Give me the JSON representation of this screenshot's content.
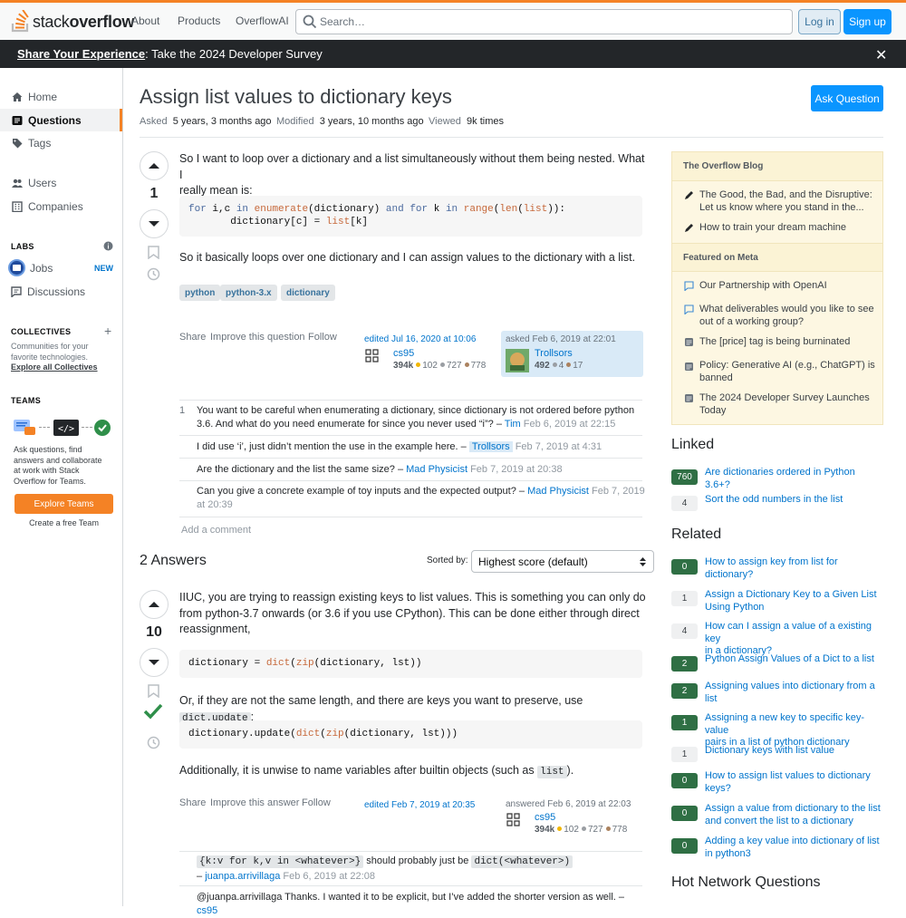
{
  "header": {
    "logo_light": "stack",
    "logo_bold": "overflow",
    "nav": [
      "About",
      "Products",
      "OverflowAI"
    ],
    "search_placeholder": "Search…",
    "login": "Log in",
    "signup": "Sign up",
    "accent": "#f48225"
  },
  "banner": {
    "link": "Share Your Experience",
    "text": ": Take the 2024 Developer Survey",
    "close": "✕"
  },
  "leftnav": {
    "home": "Home",
    "questions": "Questions",
    "tags": "Tags",
    "users": "Users",
    "companies": "Companies",
    "labs_title": "LABS",
    "jobs": "Jobs",
    "new_badge": "NEW",
    "discussions": "Discussions",
    "collectives_title": "COLLECTIVES",
    "collectives_desc_1": "Communities for your",
    "collectives_desc_2": "favorite technologies.",
    "collectives_link": "Explore all Collectives",
    "teams_title": "TEAMS",
    "teams_desc": [
      "Ask questions, find",
      "answers and collaborate",
      "at work with Stack",
      "Overflow for Teams."
    ],
    "explore_teams": "Explore Teams",
    "create_team": "Create a free Team"
  },
  "question": {
    "title": "Assign list values to dictionary keys",
    "ask_button": "Ask Question",
    "asked_label": "Asked",
    "asked_value": "5 years, 3 months ago",
    "modified_label": "Modified",
    "modified_value": "3 years, 10 months ago",
    "viewed_label": "Viewed",
    "viewed_value": "9k times",
    "score": "1",
    "body_1a": "So I want to loop over a dictionary and a list simultaneously without them being nested. What I",
    "body_1b": "really mean is:",
    "code_line1": {
      "p1": "for",
      "p2": " i,c ",
      "p3": "in",
      "p4": " ",
      "p5": "enumerate",
      "p6": "(dictionary) ",
      "p7": "and",
      "p8": " ",
      "p9": "for",
      "p10": " k ",
      "p11": "in",
      "p12": " ",
      "p13": "range",
      "p14": "(",
      "p15": "len",
      "p16": "(",
      "p17": "list",
      "p18": ")):"
    },
    "code_line2": {
      "p1": "       dictionary[c] = ",
      "p2": "list",
      "p3": "[k]"
    },
    "body_2": "So it basically loops over one dictionary and I can assign values to the dictionary with a list.",
    "tags": [
      "python",
      "python-3.x",
      "dictionary"
    ],
    "menu": [
      "Share",
      "Improve this question",
      "Follow"
    ],
    "edited": "edited Jul 16, 2020 at 10:06",
    "editor": "cs95",
    "editor_rep": "394k",
    "editor_gold": "102",
    "editor_silver": "727",
    "editor_bronze": "778",
    "asked": "asked Feb 6, 2019 at 22:01",
    "asker": "Trollsors",
    "asker_rep": "492",
    "asker_silver": "4",
    "asker_bronze": "17"
  },
  "comments": [
    {
      "score": "1",
      "text1": "You want to be careful when enumerating a dictionary, since dictionary is not ordered before python",
      "text2": "3.6. And what do you need enumerate for since you never used “i”? –",
      "user": "Tim",
      "date": "Feb 6, 2019 at 22:15"
    },
    {
      "text": "I did use ‘i’, just didn’t mention the use in the example here. –",
      "user": "Trollsors",
      "date": "Feb 7, 2019 at 4:31"
    },
    {
      "text": "Are the dictionary and the list the same size? –",
      "user": "Mad Physicist",
      "date": "Feb 7, 2019 at 20:38"
    },
    {
      "text": "Can you give a concrete example of toy inputs and the expected output? –",
      "user": "Mad Physicist",
      "date1": "Feb 7, 2019",
      "date2": "at 20:39"
    }
  ],
  "add_comment": "Add a comment",
  "answers": {
    "count_label": "2 Answers",
    "sorted_by": "Sorted by:",
    "sort_value": "Highest score (default)",
    "score": "10",
    "body_1a": "IIUC, you are trying to reassign existing keys to list values. This is something you can only do",
    "body_1b": "from python-3.7 onwards (or 3.6 if you use CPython). This can be done either through direct",
    "body_1c": "reassignment,",
    "code1": {
      "p1": "dictionary = ",
      "p2": "dict",
      "p3": "(",
      "p4": "zip",
      "p5": "(dictionary, lst))"
    },
    "body_2": "Or, if they are not the same length, and there are keys you want to preserve, use",
    "body_2_code": "dict.update",
    "body_2_end": ":",
    "code2": {
      "p1": "dictionary.update(",
      "p2": "dict",
      "p3": "(",
      "p4": "zip",
      "p5": "(dictionary, lst)))"
    },
    "body_3": "Additionally, it is unwise to name variables after builtin objects (such as",
    "body_3_code": "list",
    "body_3_end": ").",
    "menu": [
      "Share",
      "Improve this answer",
      "Follow"
    ],
    "edited": "edited Feb 7, 2019 at 20:35",
    "answered": "answered Feb 6, 2019 at 22:03",
    "author": "cs95",
    "author_rep": "394k",
    "author_gold": "102",
    "author_silver": "727",
    "author_bronze": "778",
    "comment1_code1": "{k:v for k,v in <whatever>}",
    "comment1_mid": " should probably just be ",
    "comment1_code2": "dict(<whatever>)",
    "comment1_dash": "–",
    "comment1_user": "juanpa.arrivillaga",
    "comment1_date": "Feb 6, 2019 at 22:08",
    "comment2_text": "@juanpa.arrivillaga Thanks. I wanted it to be explicit, but I’ve added the shorter version as well. –",
    "comment2_user": "cs95"
  },
  "sidebar": {
    "blog_title": "The Overflow Blog",
    "blog_items": [
      {
        "l1": "The Good, the Bad, and the Disruptive:",
        "l2": "Let us know where you stand in the..."
      },
      {
        "l1": "How to train your dream machine"
      }
    ],
    "meta_title": "Featured on Meta",
    "meta_items": [
      {
        "l1": "Our Partnership with OpenAI"
      },
      {
        "l1": "What deliverables would you like to see",
        "l2": "out of a working group?"
      },
      {
        "l1": "The [price] tag is being burninated"
      },
      {
        "l1": "Policy: Generative AI (e.g., ChatGPT) is",
        "l2": "banned"
      },
      {
        "l1": "The 2024 Developer Survey Launches",
        "l2": "Today"
      }
    ],
    "linked_title": "Linked",
    "linked": [
      {
        "count": "760",
        "l1": "Are dictionaries ordered in Python 3.6+?"
      },
      {
        "count": "4",
        "l1": "Sort the odd numbers in the list"
      }
    ],
    "related_title": "Related",
    "related": [
      {
        "count": "0",
        "l1": "How to assign key from list for",
        "l2": "dictionary?"
      },
      {
        "count": "1",
        "l1": "Assign a Dictionary Key to a Given List",
        "l2": "Using Python"
      },
      {
        "count": "4",
        "l1": "How can I assign a value of a existing key",
        "l2": "in a dictionary?"
      },
      {
        "count": "2",
        "l1": "Python Assign Values of a Dict to a list"
      },
      {
        "count": "2",
        "l1": "Assigning values into dictionary from a",
        "l2": "list"
      },
      {
        "count": "1",
        "l1": "Assigning a new key to specific key-value",
        "l2": "pairs in a list of python dictionary"
      },
      {
        "count": "1",
        "l1": "Dictionary keys with list value"
      },
      {
        "count": "0",
        "l1": "How to assign list values to dictionary",
        "l2": "keys?"
      },
      {
        "count": "0",
        "l1": "Assign a value from dictionary to the list",
        "l2": "and convert the list to a dictionary"
      },
      {
        "count": "0",
        "l1": "Adding a key value into dictionary of list",
        "l2": "in python3"
      }
    ],
    "hot_title": "Hot Network Questions"
  }
}
